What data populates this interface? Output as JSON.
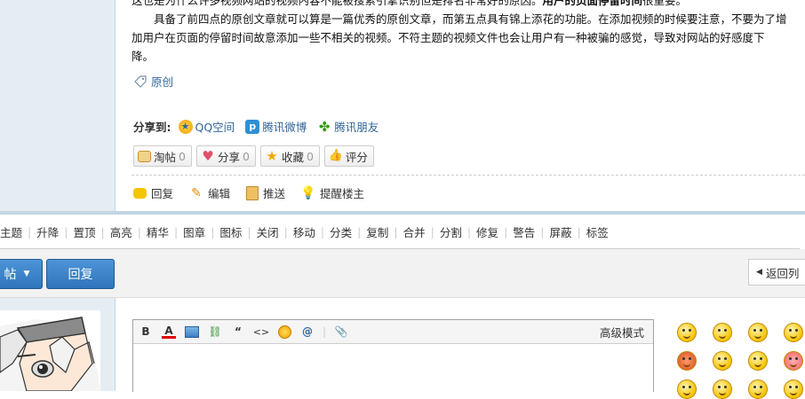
{
  "post": {
    "para0": "这也是为什么许多视频网站的视频内容不能被搜索引擎识别但是排名非常好的原因。",
    "para0_bold": "用户的页面停留时间",
    "para0_tail": "很重要。",
    "para1_line1": "　　具备了前四点的原创文章就可以算是一篇优秀的原创文章，而第五点具有锦上添花的功能。在添加视频的时候要注意，不要为了增",
    "para1_line2": "加用户在页面的停留时间故意添加一些不相关的视频。不符主题的视频文件也会让用户有一种被骗的感觉，导致对网站的好感度下",
    "para1_line3": "降。",
    "tag_label": "原创"
  },
  "share": {
    "label": "分享到:",
    "items": [
      {
        "label": "QQ空间",
        "icon": "qzone-icon"
      },
      {
        "label": "腾讯微博",
        "icon": "tencent-weibo-icon"
      },
      {
        "label": "腾讯朋友",
        "icon": "clover-icon"
      }
    ]
  },
  "post_buttons": [
    {
      "label": "淘帖",
      "count": "0",
      "icon": "tray-icon"
    },
    {
      "label": "分享",
      "count": "0",
      "icon": "heart-icon"
    },
    {
      "label": "收藏",
      "count": "0",
      "icon": "star-icon"
    },
    {
      "label": "评分",
      "count": "",
      "icon": "thumb-icon"
    }
  ],
  "actions": [
    {
      "label": "回复",
      "icon": "reply-bubble-icon"
    },
    {
      "label": "编辑",
      "icon": "pencil-icon"
    },
    {
      "label": "推送",
      "icon": "push-icon"
    },
    {
      "label": "提醒楼主",
      "icon": "bulb-icon"
    }
  ],
  "modbar": [
    "主题",
    "升降",
    "置顶",
    "高亮",
    "精华",
    "图章",
    "图标",
    "关闭",
    "移动",
    "分类",
    "复制",
    "合并",
    "分割",
    "修复",
    "警告",
    "屏蔽",
    "标签"
  ],
  "replybar": {
    "post_button": "帖",
    "reply_button": "回复",
    "back_button": "返回列"
  },
  "editor": {
    "mode_label": "高级模式",
    "tools": [
      "B",
      "A",
      "image",
      "link",
      "“",
      "<>",
      "emoji",
      "@",
      "attach"
    ]
  }
}
